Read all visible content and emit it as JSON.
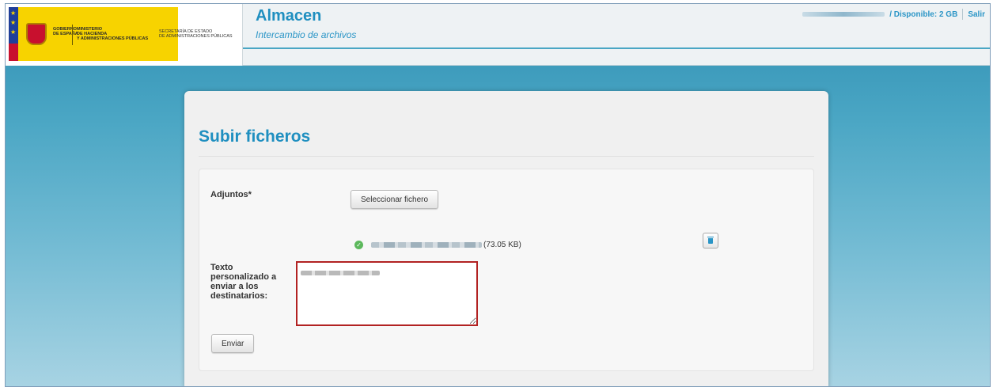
{
  "header": {
    "gov_logo": {
      "line1": "GOBIERNO",
      "line2": "DE ESPAÑA",
      "ministry1": "MINISTERIO",
      "ministry2": "DE HACIENDA",
      "ministry3": "Y ADMINISTRACIONES PÚBLICAS"
    },
    "secretaria1": "SECRETARÍA DE ESTADO",
    "secretaria2": "DE ADMINISTRACIONES PÚBLICAS",
    "app_title": "Almacen",
    "app_subtitle": "Intercambio de archivos",
    "quota": "/ Disponible: 2 GB",
    "logout_label": "Salir"
  },
  "panel": {
    "title": "Subir ficheros",
    "attachments_label": "Adjuntos*",
    "select_file_label": "Seleccionar fichero",
    "file": {
      "size": "(73.05 KB)",
      "status_icon": "check-circle-icon"
    },
    "delete_icon": "trash-icon",
    "message_label_1": "Texto",
    "message_label_2": "personalizado a",
    "message_label_3": "enviar a los",
    "message_label_4": "destinatarios:",
    "submit_label": "Enviar"
  },
  "colors": {
    "accent": "#1f8fc0",
    "error_border": "#b22222",
    "success": "#5cb85c"
  }
}
